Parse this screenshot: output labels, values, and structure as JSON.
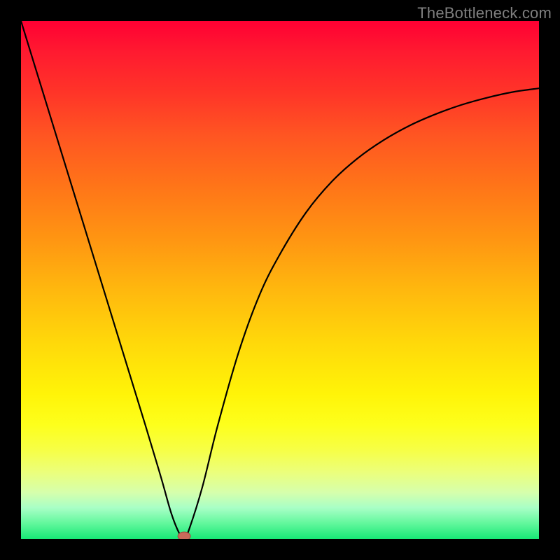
{
  "watermark": "TheBottleneck.com",
  "colors": {
    "frame": "#000000",
    "curve": "#000000",
    "marker_fill": "#c96a5a",
    "marker_stroke": "#a04a3e"
  },
  "chart_data": {
    "type": "line",
    "title": "",
    "xlabel": "",
    "ylabel": "",
    "xlim": [
      0,
      100
    ],
    "ylim": [
      0,
      100
    ],
    "grid": false,
    "series": [
      {
        "name": "bottleneck-curve",
        "x": [
          0,
          4,
          8,
          12,
          16,
          20,
          24,
          27,
          29,
          30.5,
          31.5,
          32.5,
          35,
          38,
          42,
          46,
          50,
          55,
          60,
          65,
          70,
          75,
          80,
          85,
          90,
          95,
          100
        ],
        "y": [
          100,
          87,
          74,
          61,
          48,
          35,
          22,
          12,
          5,
          1.2,
          0,
          2,
          10,
          22,
          36,
          47,
          55,
          63,
          69,
          73.5,
          77,
          79.8,
          82,
          83.8,
          85.2,
          86.3,
          87
        ]
      }
    ],
    "annotations": [
      {
        "name": "optimal-marker",
        "x": 31.5,
        "y": 0
      }
    ]
  }
}
